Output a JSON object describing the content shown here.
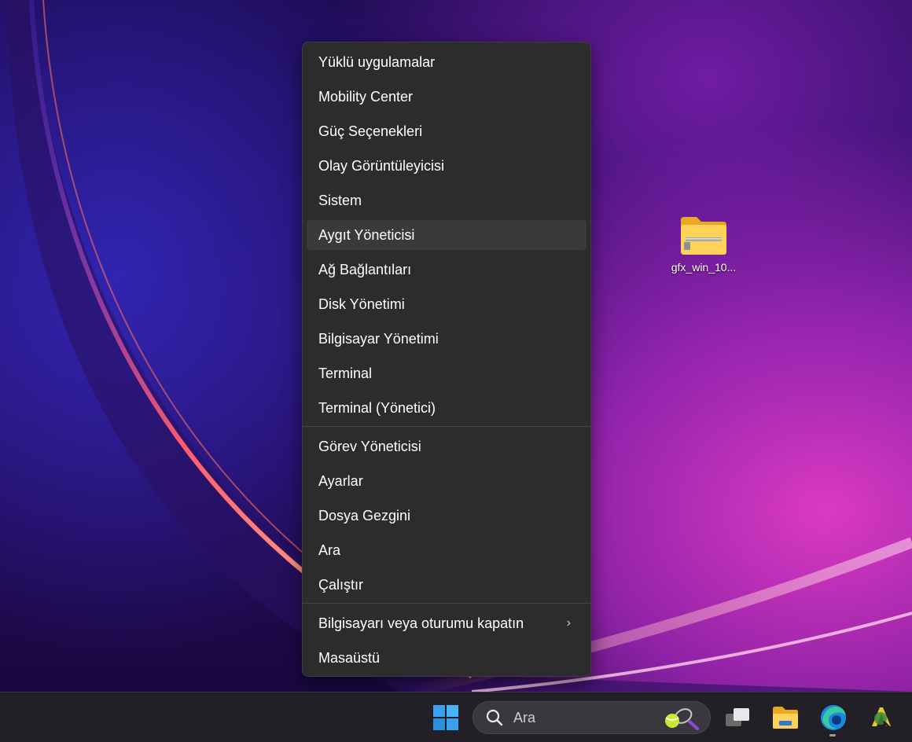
{
  "desktop": {
    "icons": [
      {
        "label": "gfx_win_10..."
      }
    ]
  },
  "context_menu": {
    "items": [
      {
        "label": "Yüklü uygulamalar"
      },
      {
        "label": "Mobility Center"
      },
      {
        "label": "Güç Seçenekleri"
      },
      {
        "label": "Olay Görüntüleyicisi"
      },
      {
        "label": "Sistem"
      },
      {
        "label": "Aygıt Yöneticisi"
      },
      {
        "label": "Ağ Bağlantıları"
      },
      {
        "label": "Disk Yönetimi"
      },
      {
        "label": "Bilgisayar Yönetimi"
      },
      {
        "label": "Terminal"
      },
      {
        "label": "Terminal (Yönetici)"
      },
      {
        "label": "Görev Yöneticisi"
      },
      {
        "label": "Ayarlar"
      },
      {
        "label": "Dosya Gezgini"
      },
      {
        "label": "Ara"
      },
      {
        "label": "Çalıştır"
      },
      {
        "label": "Bilgisayarı veya oturumu kapatın"
      },
      {
        "label": "Masaüstü"
      }
    ],
    "hovered_item": "Aygıt Yöneticisi",
    "submenu_chevron": "›"
  },
  "taskbar": {
    "search": {
      "placeholder": "Ara"
    },
    "pinned": [
      {
        "icon": "windows-start-icon"
      },
      {
        "icon": "task-view-icon"
      },
      {
        "icon": "file-explorer-icon"
      },
      {
        "icon": "edge-browser-icon"
      },
      {
        "icon": "app-icon"
      }
    ]
  },
  "colors": {
    "menu_bg": "#2c2c2c",
    "menu_hover": "#3a3a3a",
    "taskbar_bg": "#221f27",
    "start_blue": "#3aa0f0"
  }
}
